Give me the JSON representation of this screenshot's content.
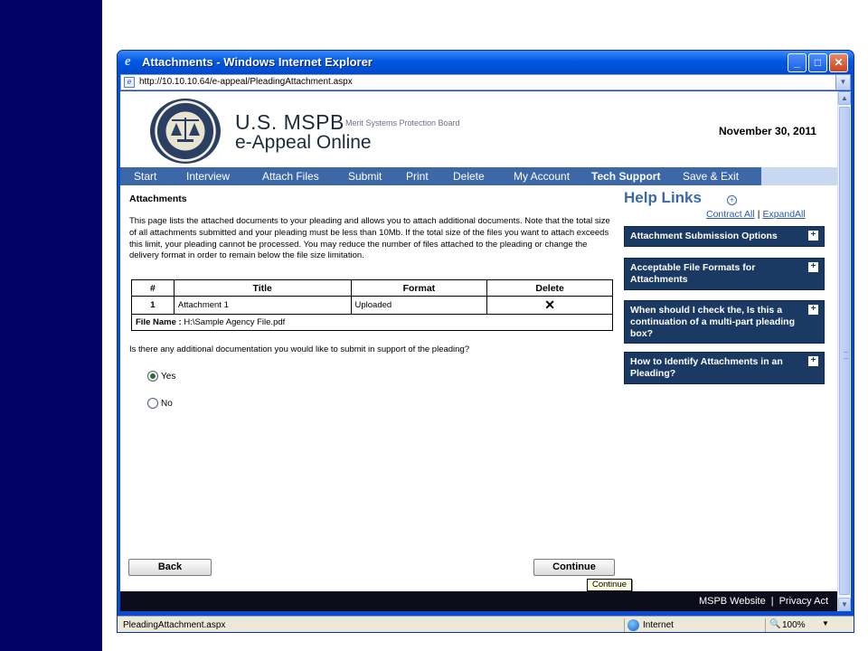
{
  "window": {
    "title": "Attachments - Windows Internet Explorer",
    "url": "http://10.10.10.64/e-appeal/PleadingAttachment.aspx"
  },
  "header": {
    "brand_main": "U.S. MSPB",
    "brand_sub": "Merit Systems Protection Board",
    "brand_app": "e-Appeal Online",
    "date": "November 30, 2011"
  },
  "nav": {
    "items": [
      {
        "label": "Start"
      },
      {
        "label": "Interview"
      },
      {
        "label": "Attach Files"
      },
      {
        "label": "Submit"
      },
      {
        "label": "Print"
      },
      {
        "label": "Delete"
      },
      {
        "label": "My Account"
      },
      {
        "label": "Tech Support"
      },
      {
        "label": "Save & Exit"
      }
    ]
  },
  "content": {
    "title": "Attachments",
    "body": "This page lists the attached documents to your pleading and allows you to attach additional documents. Note that the total size of all attachments submitted and your pleading must be less than 10Mb. If the total size of the files you want to attach exceeds this limit, your pleading cannot be processed. You may reduce the number of files attached to the pleading or change the delivery format in order to remain below the file size limitation.",
    "table": {
      "headers": [
        "#",
        "Title",
        "Format",
        "Delete"
      ],
      "rows": [
        {
          "num": "1",
          "title": "Attachment 1",
          "format": "Uploaded",
          "delete": "✕"
        }
      ],
      "file_label": "File Name :",
      "file_value": "H:\\Sample Agency File.pdf"
    },
    "question": "Is there any additional documentation you would like to submit in support of the pleading?",
    "options": [
      {
        "label": "Yes",
        "selected": true
      },
      {
        "label": "No",
        "selected": false
      }
    ]
  },
  "help": {
    "title": "Help Links",
    "plus": "+",
    "contract_all": "Contract All",
    "separator": "|",
    "expand_all": "ExpandAll",
    "boxes": [
      {
        "label": "Attachment Submission Options"
      },
      {
        "label": "Acceptable File Formats for Attachments"
      },
      {
        "label": "When should I check the, Is this a continuation of a multi-part pleading box?"
      },
      {
        "label": "How to Identify Attachments in an Pleading?"
      }
    ],
    "expand_glyph": "+"
  },
  "buttons": {
    "back": "Back",
    "continue": "Continue",
    "tooltip": "Continue"
  },
  "footer": {
    "website": "MSPB Website",
    "separator": "|",
    "privacy": "Privacy Act"
  },
  "status": {
    "text": "PleadingAttachment.aspx",
    "zone": "Internet",
    "zoom": "100%"
  },
  "colors": {
    "nav_bg": "#3d68a8",
    "help_box_bg": "#1b3a63",
    "slide_bar": "#000066",
    "window_frame": "#0a4bd6"
  }
}
